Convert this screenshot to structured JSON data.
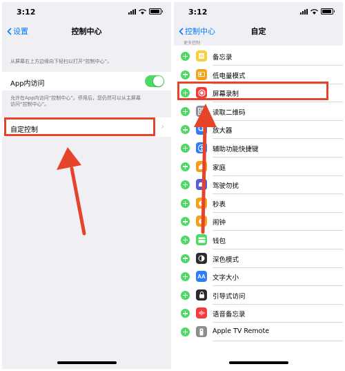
{
  "status": {
    "time": "3:12"
  },
  "left_screen": {
    "nav": {
      "back_label": "设置",
      "title": "控制中心"
    },
    "caption": "从屏幕右上方边缘向下轻扫以打开“控制中心”。",
    "app_access": {
      "label": "App内访问",
      "on": true
    },
    "footnote_line1": "允许在App内访问“控制中心”。停用后，您仍然可以从主屏幕",
    "footnote_line2": "访问“控制中心”。",
    "customize_label": "自定控制"
  },
  "right_screen": {
    "nav": {
      "back_label": "控制中心",
      "title": "自定"
    },
    "section_header": "更多控制",
    "items": [
      {
        "label": "备忘录",
        "icon": "notes-icon",
        "color": "#f7cf38"
      },
      {
        "label": "低电量模式",
        "icon": "low-power-icon",
        "color": "#f4a21a"
      },
      {
        "label": "屏幕录制",
        "icon": "screen-record-icon",
        "color": "#f43b3b"
      },
      {
        "label": "读取二维码",
        "icon": "qr-code-icon",
        "color": "#8e8e93"
      },
      {
        "label": "放大器",
        "icon": "magnifier-icon",
        "color": "#2f7cf6"
      },
      {
        "label": "辅助功能快捷键",
        "icon": "accessibility-icon",
        "color": "#2f7cf6"
      },
      {
        "label": "家庭",
        "icon": "home-icon",
        "color": "#f49e1c"
      },
      {
        "label": "驾驶勿扰",
        "icon": "car-icon",
        "color": "#5b5bd6"
      },
      {
        "label": "秒表",
        "icon": "stopwatch-icon",
        "color": "#f4a21a"
      },
      {
        "label": "闹钟",
        "icon": "alarm-icon",
        "color": "#f4a21a"
      },
      {
        "label": "钱包",
        "icon": "wallet-icon",
        "color": "#4cd964"
      },
      {
        "label": "深色模式",
        "icon": "dark-mode-icon",
        "color": "#2c2c2e"
      },
      {
        "label": "文字大小",
        "icon": "text-size-icon",
        "color": "#2f7cf6"
      },
      {
        "label": "引导式访问",
        "icon": "guided-access-icon",
        "color": "#2c2c2e"
      },
      {
        "label": "语音备忘录",
        "icon": "voice-memo-icon",
        "color": "#f43b3b"
      },
      {
        "label": "Apple TV Remote",
        "icon": "tv-remote-icon",
        "color": "#8e8e93"
      }
    ]
  },
  "colors": {
    "accent": "#007aff",
    "annotation": "#e5432a",
    "toggle_on": "#4cd964"
  }
}
